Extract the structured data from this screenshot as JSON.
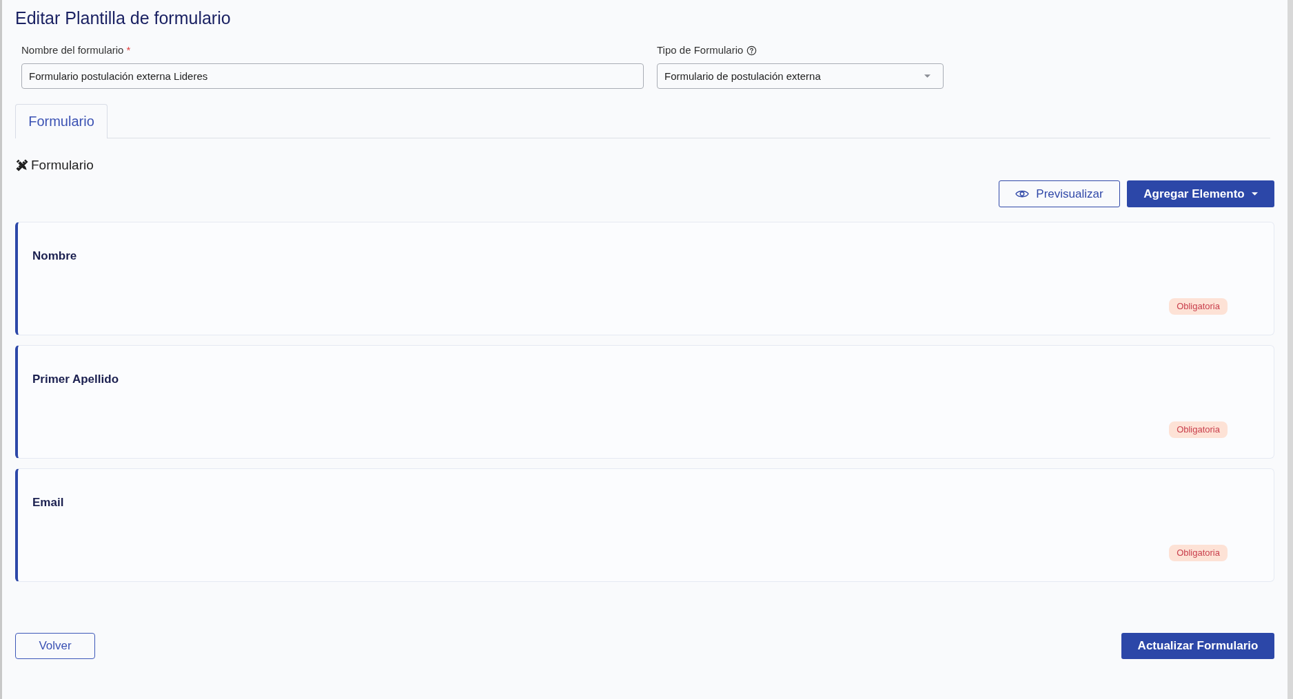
{
  "page": {
    "title": "Editar Plantilla de formulario"
  },
  "fields": [
    {
      "kind": "text",
      "label": "Nombre del formulario",
      "required_mark": "*",
      "value": "Formulario postulación externa Lideres"
    },
    {
      "kind": "select",
      "label": "Tipo de Formulario",
      "help": true,
      "value": "Formulario de postulación externa"
    }
  ],
  "tabs": [
    {
      "label": "Formulario",
      "selected": true
    }
  ],
  "section": {
    "title": "Formulario"
  },
  "toolbar": [
    {
      "kind": "preview",
      "label": "Previsualizar"
    },
    {
      "kind": "dropdown",
      "label": "Agregar Elemento"
    }
  ],
  "elements": [
    {
      "label": "Nombre",
      "badge": "Obligatoria"
    },
    {
      "label": "Primer Apellido",
      "badge": "Obligatoria"
    },
    {
      "label": "Email",
      "badge": "Obligatoria"
    }
  ],
  "footer": [
    {
      "kind": "outline",
      "label": "Volver"
    },
    {
      "kind": "primary",
      "label": "Actualizar Formulario"
    }
  ]
}
